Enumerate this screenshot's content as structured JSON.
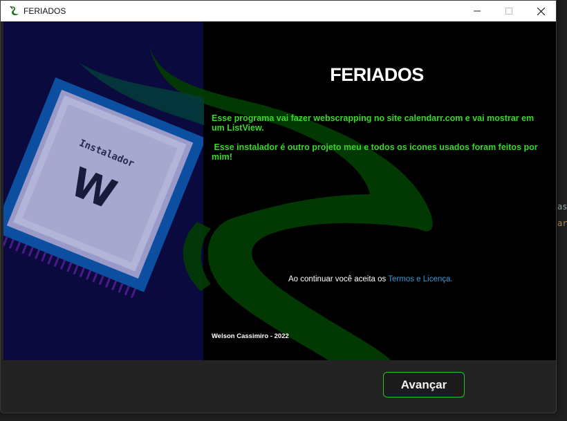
{
  "window": {
    "title": "FERIADOS",
    "icons": {
      "app": "leaf-app-icon",
      "minimize": "minimize-icon",
      "maximize": "maximize-icon",
      "close": "close-icon"
    }
  },
  "banner": {
    "chip_label": "Instalador",
    "chip_letter": "W"
  },
  "main": {
    "heading": "FERIADOS",
    "description_1": "Esse programa vai fazer webscrapping no site calendarr.com e vai mostrar em um ListView.",
    "description_2": " Esse instalador é outro projeto meu e todos os icones usados foram feitos por mim!",
    "terms_prefix": "Ao continuar você aceita os ",
    "terms_link": "Termos e Licença.",
    "author": "Welson Cassimiro - 2022"
  },
  "footer": {
    "next_label": "Avançar"
  },
  "colors": {
    "accent_green": "#39d82a",
    "link_blue": "#2f9bd6",
    "panel_navy": "#0a0a3e",
    "button_border": "#29c229"
  }
}
